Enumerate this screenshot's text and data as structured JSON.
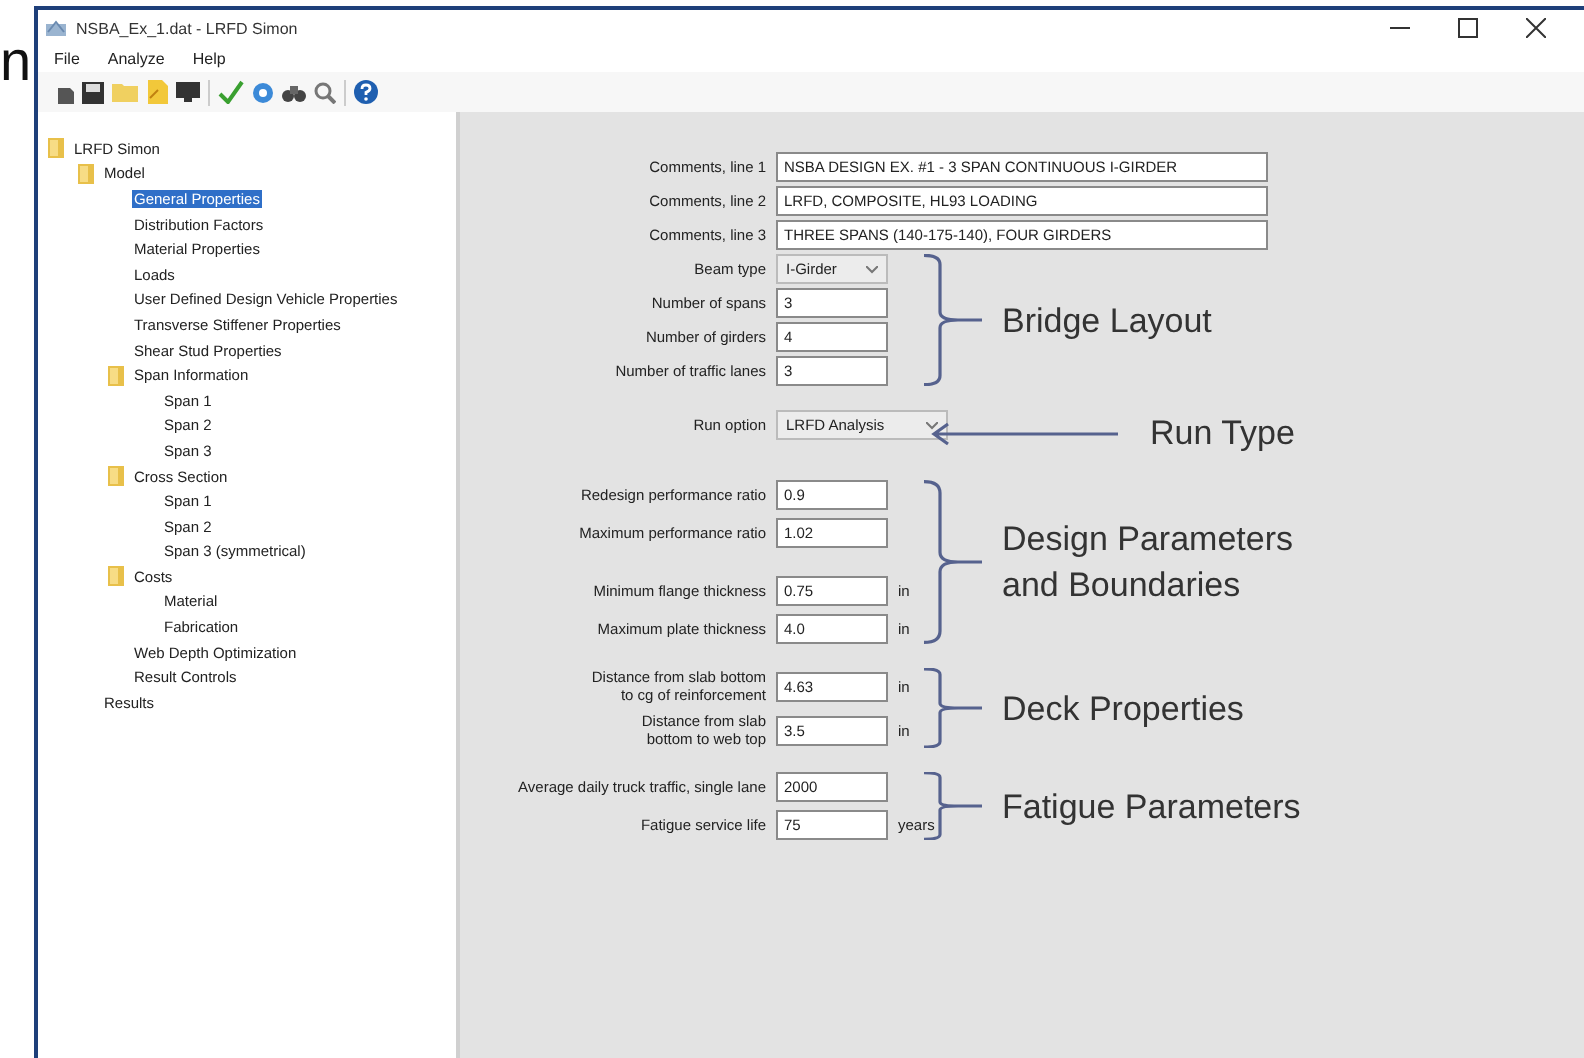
{
  "slide_fragment": "n",
  "window": {
    "title": "NSBA_Ex_1.dat - LRFD Simon"
  },
  "menu": [
    "File",
    "Analyze",
    "Help"
  ],
  "tree": [
    {
      "label": "LRFD Simon",
      "folder": true,
      "selected": false,
      "children": [
        {
          "label": "Model",
          "folder": true,
          "selected": false,
          "children": [
            {
              "label": "General Properties",
              "folder": false,
              "selected": true
            },
            {
              "label": "Distribution Factors",
              "folder": false,
              "selected": false
            },
            {
              "label": "Material Properties",
              "folder": false,
              "selected": false
            },
            {
              "label": "Loads",
              "folder": false,
              "selected": false
            },
            {
              "label": "User Defined Design Vehicle Properties",
              "folder": false,
              "selected": false
            },
            {
              "label": "Transverse Stiffener Properties",
              "folder": false,
              "selected": false
            },
            {
              "label": "Shear Stud Properties",
              "folder": false,
              "selected": false
            },
            {
              "label": "Span Information",
              "folder": true,
              "selected": false,
              "children": [
                {
                  "label": "Span 1",
                  "folder": false,
                  "selected": false
                },
                {
                  "label": "Span 2",
                  "folder": false,
                  "selected": false
                },
                {
                  "label": "Span 3",
                  "folder": false,
                  "selected": false
                }
              ]
            },
            {
              "label": "Cross Section",
              "folder": true,
              "selected": false,
              "children": [
                {
                  "label": "Span 1",
                  "folder": false,
                  "selected": false
                },
                {
                  "label": "Span 2",
                  "folder": false,
                  "selected": false
                },
                {
                  "label": "Span 3 (symmetrical)",
                  "folder": false,
                  "selected": false
                }
              ]
            },
            {
              "label": "Costs",
              "folder": true,
              "selected": false,
              "children": [
                {
                  "label": "Material",
                  "folder": false,
                  "selected": false
                },
                {
                  "label": "Fabrication",
                  "folder": false,
                  "selected": false
                }
              ]
            },
            {
              "label": "Web Depth Optimization",
              "folder": false,
              "selected": false
            },
            {
              "label": "Result Controls",
              "folder": false,
              "selected": false
            }
          ]
        },
        {
          "label": "Results",
          "folder": false,
          "selected": false
        }
      ]
    }
  ],
  "form": {
    "sections": [
      {
        "groups": [
          [
            {
              "label": "Comments, line 1",
              "kind": "long_text",
              "value": "NSBA DESIGN EX. #1 - 3 SPAN CONTINUOUS I-GIRDER"
            },
            {
              "label": "Comments, line 2",
              "kind": "long_text",
              "value": "LRFD, COMPOSITE, HL93 LOADING"
            },
            {
              "label": "Comments, line 3",
              "kind": "long_text",
              "value": "THREE SPANS (140-175-140), FOUR GIRDERS"
            }
          ]
        ]
      },
      {
        "annotation": {
          "kind": "bracket",
          "label": "Bridge Layout"
        },
        "groups": [
          [
            {
              "label": "Beam type",
              "kind": "select",
              "value": "I-Girder"
            },
            {
              "label": "Number of spans",
              "kind": "text",
              "value": "3"
            },
            {
              "label": "Number of girders",
              "kind": "text",
              "value": "4"
            },
            {
              "label": "Number of traffic lanes",
              "kind": "text",
              "value": "3"
            }
          ]
        ]
      },
      {
        "annotation": {
          "kind": "arrow",
          "label": "Run Type"
        },
        "groups": [
          [
            {
              "label": "Run option",
              "kind": "wide_select",
              "value": "LRFD Analysis"
            }
          ]
        ]
      },
      {
        "annotation": {
          "kind": "bracket",
          "label": "Design Parameters\nand Boundaries"
        },
        "groups": [
          [
            {
              "label": "Redesign performance ratio",
              "kind": "text",
              "value": "0.9"
            },
            {
              "label": "Maximum performance ratio",
              "kind": "text",
              "value": "1.02"
            }
          ],
          [
            {
              "label": "Minimum flange thickness",
              "kind": "text",
              "value": "0.75",
              "unit": "in"
            },
            {
              "label": "Maximum plate thickness",
              "kind": "text",
              "value": "4.0",
              "unit": "in"
            }
          ]
        ]
      },
      {
        "annotation": {
          "kind": "bracket",
          "label": "Deck Properties"
        },
        "groups": [
          [
            {
              "label": "Distance from slab bottom\nto cg of reinforcement",
              "kind": "text",
              "value": "4.63",
              "unit": "in"
            },
            {
              "label": "Distance from slab\nbottom to web top",
              "kind": "text",
              "value": "3.5",
              "unit": "in"
            }
          ]
        ]
      },
      {
        "annotation": {
          "kind": "bracket",
          "label": "Fatigue Parameters"
        },
        "groups": [
          [
            {
              "label": "Average daily truck traffic, single lane",
              "kind": "text",
              "value": "2000"
            },
            {
              "label": "Fatigue service life",
              "kind": "text",
              "value": "75",
              "unit": "years"
            }
          ]
        ]
      }
    ]
  }
}
